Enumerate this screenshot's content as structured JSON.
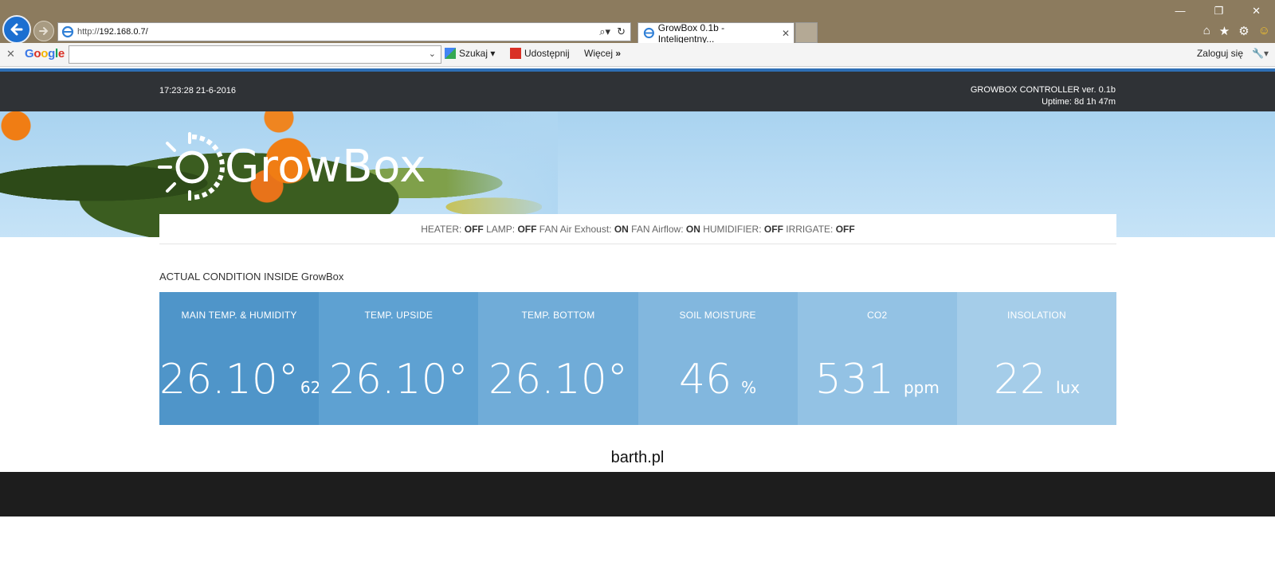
{
  "browser": {
    "url_prefix": "http://",
    "url_host": "192.168.0.7/",
    "tab_title": "GrowBox 0.1b - Inteligentny...",
    "google": {
      "logo": "Google",
      "search_label": "Szukaj",
      "share_label": "Udostępnij",
      "more_label": "Więcej",
      "login_label": "Zaloguj się"
    }
  },
  "topbar": {
    "clock": "17:23:28 21-6-2016",
    "controller": "GROWBOX CONTROLLER ver. 0.1b",
    "uptime": "Uptime: 8d 1h 47m"
  },
  "brand": {
    "name": "GrowBox"
  },
  "devices": [
    {
      "name": "HEATER:",
      "state": "OFF"
    },
    {
      "name": "LAMP:",
      "state": "OFF"
    },
    {
      "name": "FAN Air Exhoust:",
      "state": "ON"
    },
    {
      "name": "FAN Airflow:",
      "state": "ON"
    },
    {
      "name": "HUMIDIFIER:",
      "state": "OFF"
    },
    {
      "name": "IRRIGATE:",
      "state": "OFF"
    }
  ],
  "section_title": "ACTUAL CONDITION INSIDE GrowBox",
  "tiles": [
    {
      "label": "MAIN TEMP. & HUMIDITY",
      "value": "26.10°",
      "extra": "62%",
      "unit": "",
      "color": "#4f95c9"
    },
    {
      "label": "TEMP. UPSIDE",
      "value": "26.10°",
      "extra": "",
      "unit": "",
      "color": "#5ea1d2"
    },
    {
      "label": "TEMP. BOTTOM",
      "value": "26.10°",
      "extra": "",
      "unit": "",
      "color": "#70acd8"
    },
    {
      "label": "SOIL MOISTURE",
      "value": "46",
      "extra": "",
      "unit": "%",
      "color": "#82b7de"
    },
    {
      "label": "CO2",
      "value": "531",
      "extra": "",
      "unit": "ppm",
      "color": "#93c2e4"
    },
    {
      "label": "INSOLATION",
      "value": "22",
      "extra": "",
      "unit": "lux",
      "color": "#a5cde9"
    }
  ],
  "credit": "barth.pl"
}
